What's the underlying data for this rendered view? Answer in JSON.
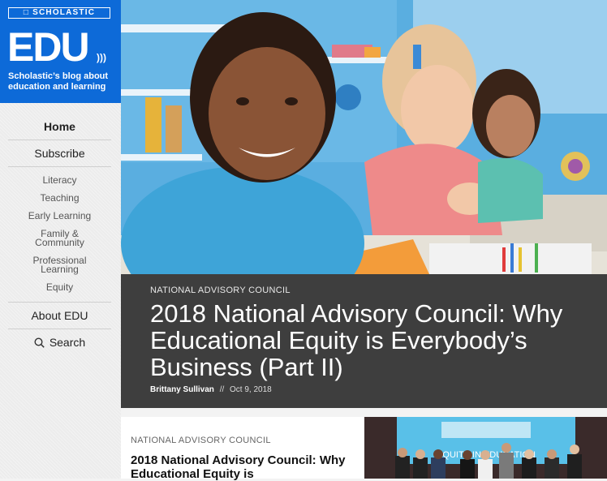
{
  "brand": {
    "publisher": "SCHOLASTIC",
    "logo_text": "EDU",
    "tagline": "Scholastic’s blog about education and learning"
  },
  "nav": {
    "home": "Home",
    "subscribe": "Subscribe",
    "categories": [
      "Literacy",
      "Teaching",
      "Early Learning",
      "Family & Community",
      "Professional Learning",
      "Equity"
    ],
    "about": "About EDU",
    "search": "Search"
  },
  "featured": {
    "category": "NATIONAL ADVISORY COUNCIL",
    "title": "2018 National Advisory Council: Why Educational Equity is Everybody’s Business (Part II)",
    "author": "Brittany Sullivan",
    "separator": "//",
    "date": "Oct 9, 2018"
  },
  "second_post": {
    "category": "NATIONAL ADVISORY COUNCIL",
    "title": "2018 National Advisory Council: Why Educational Equity is"
  },
  "thumb": {
    "banner_text": "EQUITY IN EDUCATION"
  },
  "colors": {
    "brand_blue": "#0d6ad8",
    "hero_band": "#3e3e3e"
  }
}
